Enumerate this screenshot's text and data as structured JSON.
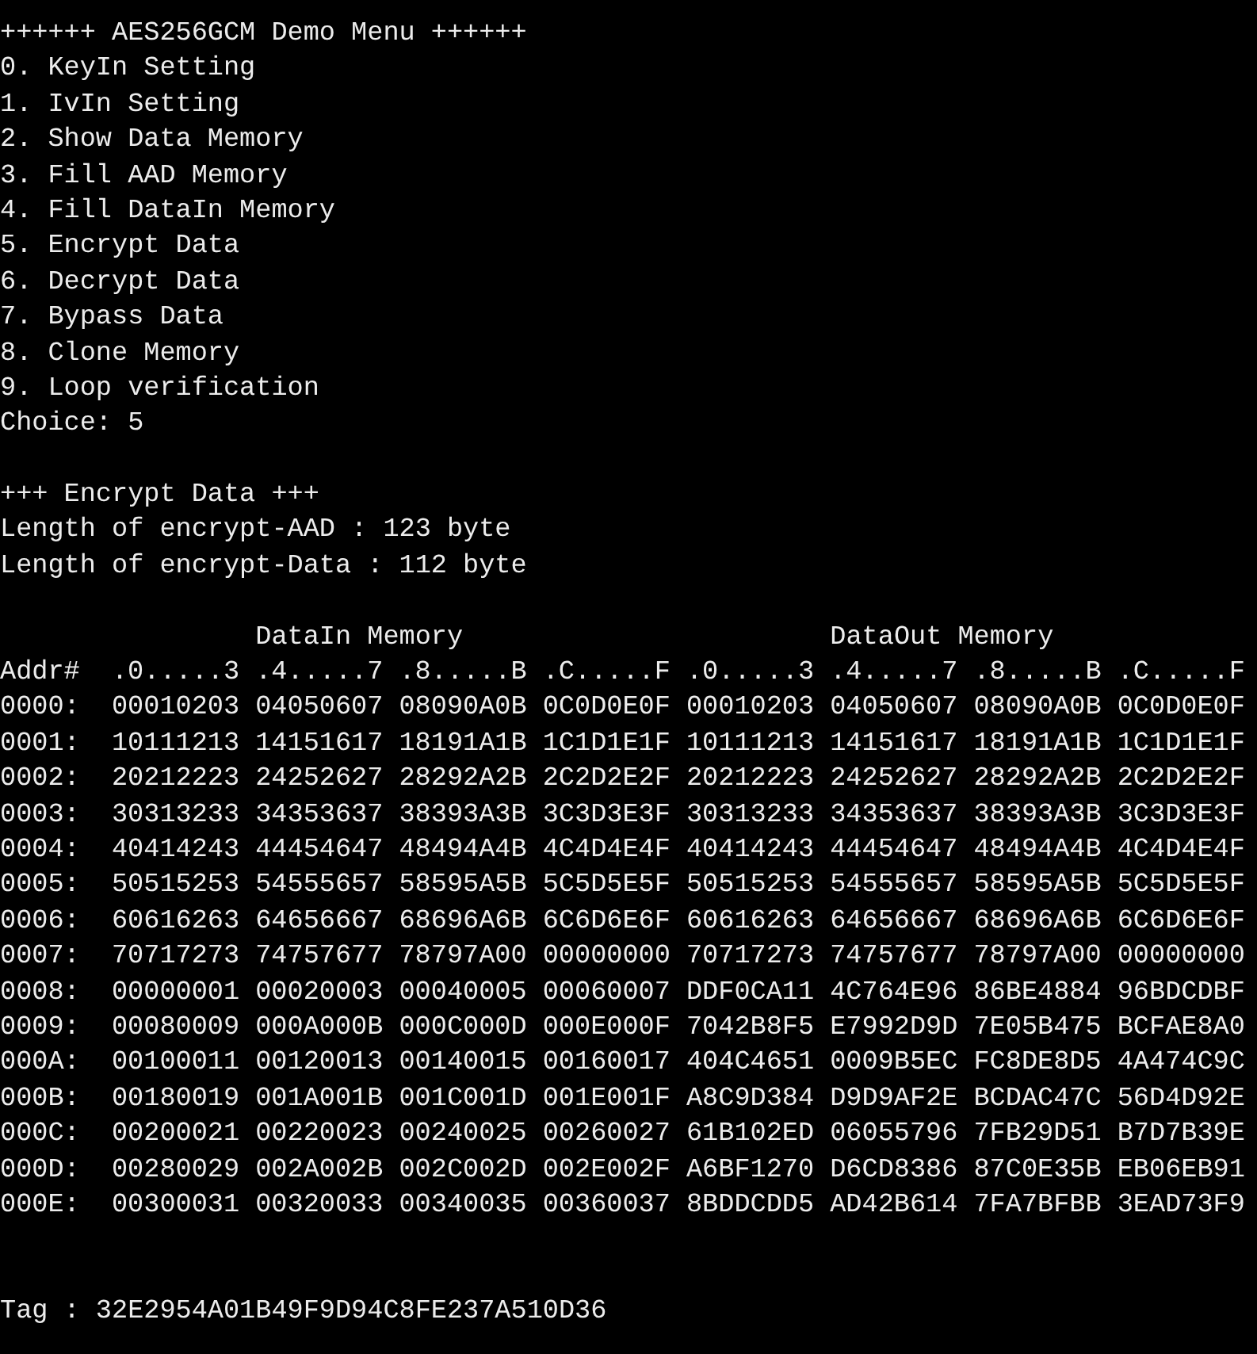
{
  "menu": {
    "title": "++++++ AES256GCM Demo Menu ++++++",
    "items": [
      "0. KeyIn Setting",
      "1. IvIn Setting",
      "2. Show Data Memory",
      "3. Fill AAD Memory",
      "4. Fill DataIn Memory",
      "5. Encrypt Data",
      "6. Decrypt Data",
      "7. Bypass Data",
      "8. Clone Memory",
      "9. Loop verification"
    ],
    "choice": "Choice: 5"
  },
  "encrypt": {
    "header": "+++ Encrypt Data +++",
    "lines": [
      "Length of encrypt-AAD : 123 byte",
      "Length of encrypt-Data : 112 byte"
    ]
  },
  "memory_table": {
    "titles": [
      "DataIn Memory",
      "DataOut Memory"
    ],
    "columns": [
      "Addr#",
      ".0.....3",
      ".4.....7",
      ".8.....B",
      ".C.....F",
      ".0.....3",
      ".4.....7",
      ".8.....B",
      ".C.....F"
    ],
    "rows": [
      {
        "cells": [
          "0000:",
          "00010203",
          "04050607",
          "08090A0B",
          "0C0D0E0F",
          "00010203",
          "04050607",
          "08090A0B",
          "0C0D0E0F"
        ]
      },
      {
        "cells": [
          "0001:",
          "10111213",
          "14151617",
          "18191A1B",
          "1C1D1E1F",
          "10111213",
          "14151617",
          "18191A1B",
          "1C1D1E1F"
        ]
      },
      {
        "cells": [
          "0002:",
          "20212223",
          "24252627",
          "28292A2B",
          "2C2D2E2F",
          "20212223",
          "24252627",
          "28292A2B",
          "2C2D2E2F"
        ]
      },
      {
        "cells": [
          "0003:",
          "30313233",
          "34353637",
          "38393A3B",
          "3C3D3E3F",
          "30313233",
          "34353637",
          "38393A3B",
          "3C3D3E3F"
        ]
      },
      {
        "cells": [
          "0004:",
          "40414243",
          "44454647",
          "48494A4B",
          "4C4D4E4F",
          "40414243",
          "44454647",
          "48494A4B",
          "4C4D4E4F"
        ]
      },
      {
        "cells": [
          "0005:",
          "50515253",
          "54555657",
          "58595A5B",
          "5C5D5E5F",
          "50515253",
          "54555657",
          "58595A5B",
          "5C5D5E5F"
        ]
      },
      {
        "cells": [
          "0006:",
          "60616263",
          "64656667",
          "68696A6B",
          "6C6D6E6F",
          "60616263",
          "64656667",
          "68696A6B",
          "6C6D6E6F"
        ]
      },
      {
        "cells": [
          "0007:",
          "70717273",
          "74757677",
          "78797A00",
          "00000000",
          "70717273",
          "74757677",
          "78797A00",
          "00000000"
        ]
      },
      {
        "cells": [
          "0008:",
          "00000001",
          "00020003",
          "00040005",
          "00060007",
          "DDF0CA11",
          "4C764E96",
          "86BE4884",
          "96BDCDBF"
        ]
      },
      {
        "cells": [
          "0009:",
          "00080009",
          "000A000B",
          "000C000D",
          "000E000F",
          "7042B8F5",
          "E7992D9D",
          "7E05B475",
          "BCFAE8A0"
        ]
      },
      {
        "cells": [
          "000A:",
          "00100011",
          "00120013",
          "00140015",
          "00160017",
          "404C4651",
          "0009B5EC",
          "FC8DE8D5",
          "4A474C9C"
        ]
      },
      {
        "cells": [
          "000B:",
          "00180019",
          "001A001B",
          "001C001D",
          "001E001F",
          "A8C9D384",
          "D9D9AF2E",
          "BCDAC47C",
          "56D4D92E"
        ]
      },
      {
        "cells": [
          "000C:",
          "00200021",
          "00220023",
          "00240025",
          "00260027",
          "61B102ED",
          "06055796",
          "7FB29D51",
          "B7D7B39E"
        ]
      },
      {
        "cells": [
          "000D:",
          "00280029",
          "002A002B",
          "002C002D",
          "002E002F",
          "A6BF1270",
          "D6CD8386",
          "87C0E35B",
          "EB06EB91"
        ]
      },
      {
        "cells": [
          "000E:",
          "00300031",
          "00320033",
          "00340035",
          "00360037",
          "8BDDCDD5",
          "AD42B614",
          "7FA7BFBB",
          "3EAD73F9"
        ]
      }
    ]
  },
  "tag": "Tag : 32E2954A01B49F9D94C8FE237A510D36"
}
